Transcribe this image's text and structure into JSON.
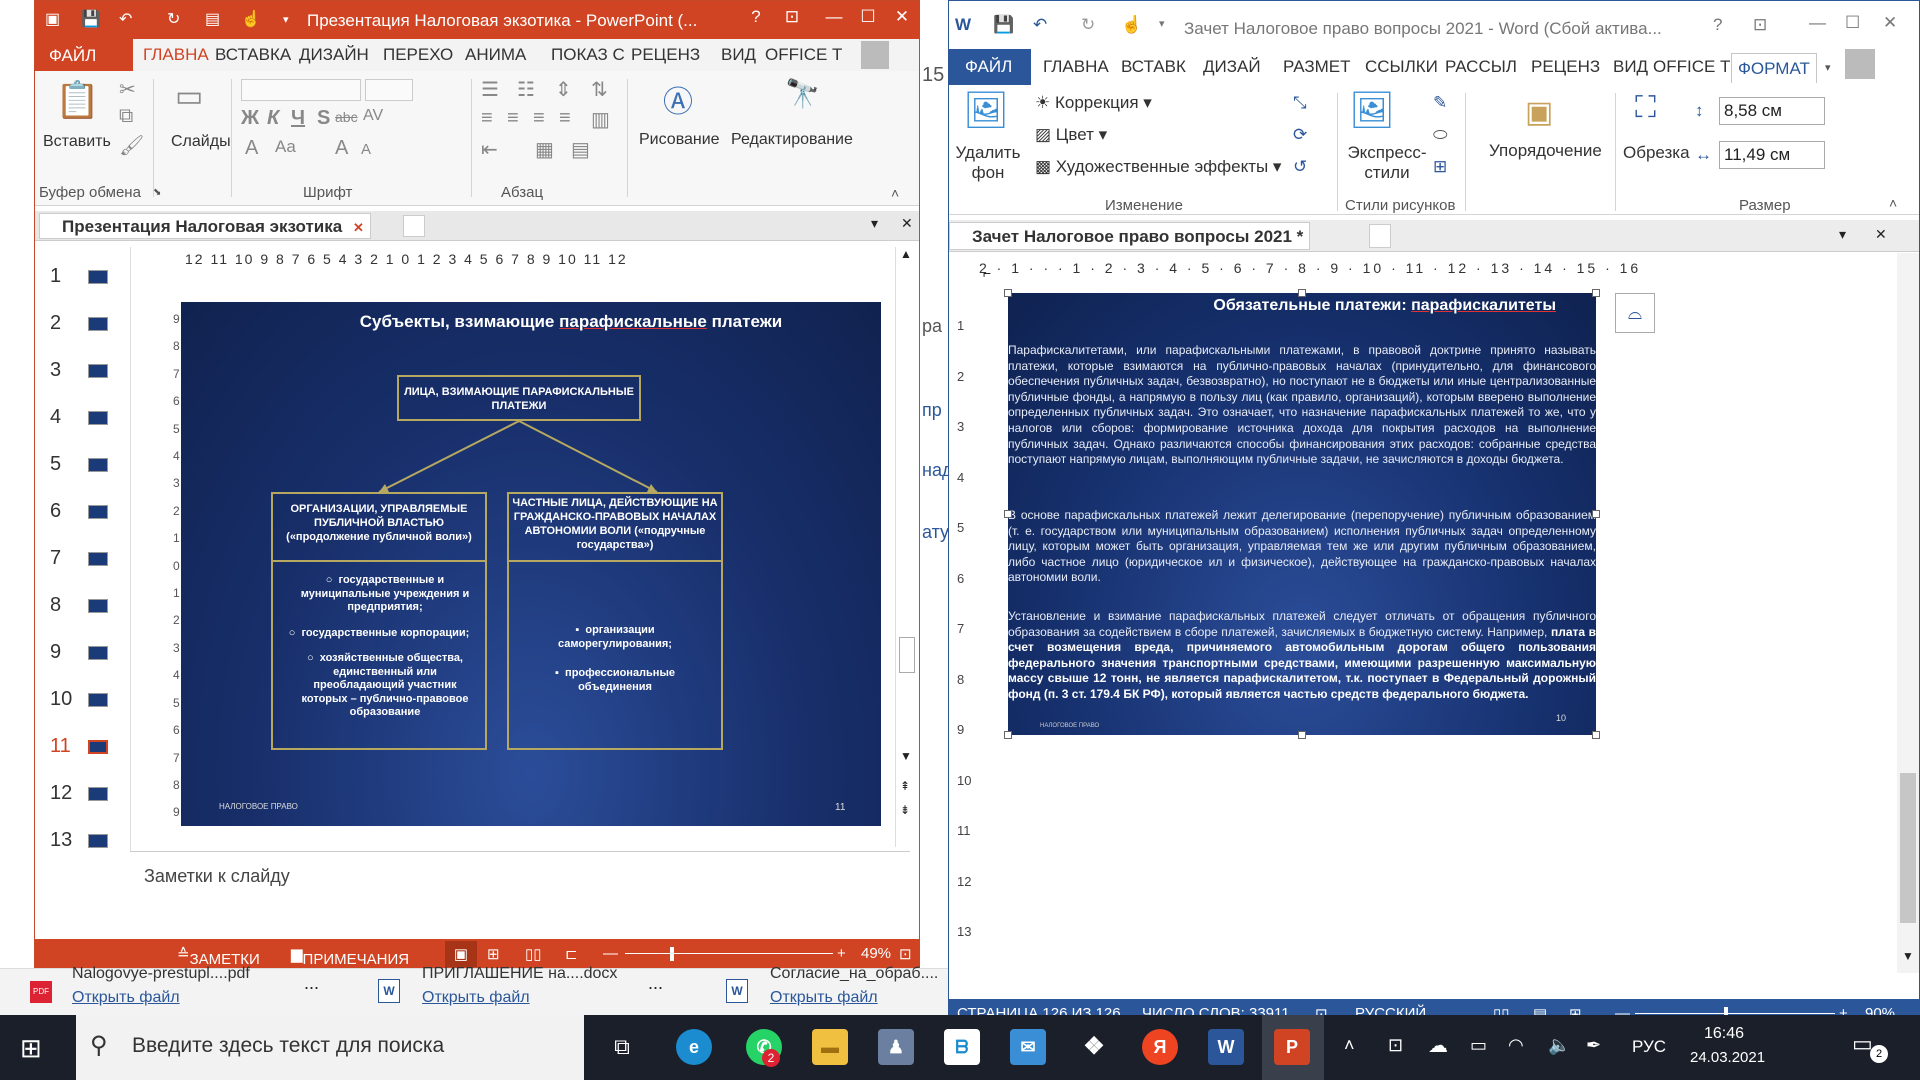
{
  "ppt": {
    "title": "Презентация Налоговая экзотика - PowerPoint (...",
    "help": "?",
    "tabs": [
      "ФАЙЛ",
      "ГЛАВНА",
      "ВСТАВКА",
      "ДИЗАЙН",
      "ПЕРЕХО",
      "АНИМА",
      "ПОКАЗ С",
      "РЕЦЕНЗ",
      "ВИД",
      "OFFICE Т"
    ],
    "ribbon": {
      "paste": "Вставить",
      "slides": "Слайды",
      "drawing": "Рисование",
      "editing": "Редактирование",
      "groups": [
        "Буфер обмена",
        "Шрифт",
        "Абзац"
      ],
      "font_letters": [
        "Ж",
        "К",
        "Ч",
        "S",
        "abc",
        "AV",
        "A",
        "Aa",
        "A",
        "A"
      ]
    },
    "doc_tab": "Презентация Налоговая экзотика",
    "ruler": "12 11 10 9 8 7 6 5 4 3 2 1 0 1 2 3 4 5 6 7 8 9 10 11 12",
    "vruler": [
      "9",
      "8",
      "7",
      "6",
      "5",
      "4",
      "3",
      "2",
      "1",
      "0",
      "1",
      "2",
      "3",
      "4",
      "5",
      "6",
      "7",
      "8",
      "9"
    ],
    "thumbnails": [
      "1",
      "2",
      "3",
      "4",
      "5",
      "6",
      "7",
      "8",
      "9",
      "10",
      "11",
      "12",
      "13"
    ],
    "selected_slide": "11",
    "notes_placeholder": "Заметки к слайду",
    "status": {
      "notes": "ЗАМЕТКИ",
      "comments": "ПРИМЕЧАНИЯ",
      "zoom": "49%",
      "zoom_value": 0.49
    }
  },
  "slide": {
    "title_pre": "Субъекты, взимающие ",
    "title_u": "парафискальные",
    "title_post": " платежи",
    "top_box": "ЛИЦА, ВЗИМАЮЩИЕ ПАРАФИСКАЛЬНЫЕ ПЛАТЕЖИ",
    "left_header": "ОРГАНИЗАЦИИ, УПРАВЛЯЕМЫЕ ПУБЛИЧНОЙ ВЛАСТЬЮ («продолжение публичной воли»)",
    "right_header": "ЧАСТНЫЕ ЛИЦА, ДЕЙСТВУЮЩИЕ НА ГРАЖДАНСКО-ПРАВОВЫХ НАЧАЛАХ АВТОНОМИИ ВОЛИ («подручные государства»)",
    "left_items": [
      "государственные и муниципальные учреждения и предприятия;",
      "государственные корпорации;",
      "хозяйственные общества, единственный или преобладающий участник которых – публично-правовое образование"
    ],
    "right_items": [
      "организации саморегулирования;",
      "профессиональные объединения"
    ],
    "footer_left": "НАЛОГОВОЕ ПРАВО",
    "footer_num": "11"
  },
  "word": {
    "title": "Зачет Налоговое право вопросы 2021 - Word (Сбой актива...",
    "help": "?",
    "tabs": [
      "ФАЙЛ",
      "ГЛАВНА",
      "ВСТАВК",
      "ДИЗАЙ",
      "РАЗМЕТ",
      "ССЫЛКИ",
      "РАССЫЛ",
      "РЕЦЕНЗ",
      "ВИД",
      "OFFICE Т",
      "ФОРМАТ"
    ],
    "ribbon": {
      "remove_bg": "Удалить фон",
      "correction": "Коррекция",
      "color": "Цвет",
      "art_effects": "Художественные эффекты",
      "change_group": "Изменение",
      "express_styles": "Экспресс-стили",
      "styles_group": "Стили рисунков",
      "arrange": "Упорядочение",
      "crop": "Обрезка",
      "height": "8,58 см",
      "width": "11,49 см",
      "size_group": "Размер"
    },
    "doc_tab": "Зачет Налоговое право вопросы 2021 *",
    "ruler": "2 · 1 · · · 1 · 2 · 3 · 4 · 5 · 6 · 7 · 8 · 9 · 10 · 11 · 12 · 13 · 14 · 15 · 16",
    "vruler": [
      "1",
      "2",
      "3",
      "4",
      "5",
      "6",
      "7",
      "8",
      "9",
      "10",
      "11",
      "12",
      "13"
    ],
    "status": {
      "page": "СТРАНИЦА 126 ИЗ 126",
      "words": "ЧИСЛО СЛОВ: 33911",
      "lang": "РУССКИЙ",
      "zoom": "90%",
      "zoom_value": 0.9
    }
  },
  "doc_image": {
    "title_pre": "Обязательные платежи: ",
    "title_u": "парафискалитеты",
    "p1": "Парафискалитетами, или парафискальными платежами, в правовой доктрине принято называть платежи, которые взимаются на публично-правовых началах (принудительно, для финансового обеспечения публичных задач, безвозвратно), но поступают не в бюджеты или иные централизованные публичные фонды, а напрямую в пользу лиц (как правило, организаций), которым вверено выполнение определенных публичных задач. Это означает, что назначение парафискальных платежей то же, что у налогов или сборов: формирование источника дохода для покрытия расходов на выполнение публичных задач. Однако различаются способы финансирования этих расходов: собранные средства поступают напрямую лицам, выполняющим публичные задачи, не зачисляются в доходы бюджета.",
    "p2": "В основе парафискальных платежей лежит делегирование (перепоручение) публичным образованием (т. е. государством или муниципальным образованием) исполнения публичных задач определенному лицу, которым может быть организация, управляемая тем же или другим публичным образованием, либо частное лицо (юридическое ил и физическое), действующее на гражданско-правовых началах автономии воли.",
    "p3_normal": "Установление и взимание парафискальных платежей следует отличать от обращения публичного образования за содействием в сборе платежей, зачисляемых в бюджетную систему. Например, ",
    "p3_bold": "плата в счет возмещения вреда, причиняемого автомобильным дорогам общего пользования федерального значения транспортными средствами, имеющими разрешенную максимальную массу свыше 12 тонн, не является парафискалитетом, т.к. поступает в Федеральный дорожный фонд (п. 3 ст. 179.4 БК РФ), который является частью средств федерального бюджета.",
    "footer_left": "НАЛОГОВОЕ ПРАВО",
    "footer_num": "10"
  },
  "filebar": [
    {
      "name": "Nalogovye-prestupl....pdf",
      "open": "Открыть файл",
      "kind": "pdf"
    },
    {
      "name": "ПРИГЛАШЕНИЕ на....docx",
      "open": "Открыть файл",
      "kind": "word"
    },
    {
      "name": "Согласие_на_обраб....",
      "open": "Открыть файл",
      "kind": "word"
    }
  ],
  "filebar_more": "...",
  "taskbar": {
    "search_placeholder": "Введите здесь текст для поиска",
    "whatsapp_badge": "2",
    "lang": "РУС",
    "time": "16:46",
    "date": "24.03.2021",
    "notif_count": "2"
  },
  "background_fragments": [
    "15",
    "ра",
    "пр",
    "над",
    "ату"
  ],
  "colors": {
    "ppt_accent": "#d04423",
    "word_accent": "#2b579a",
    "slide_border": "#b6a860",
    "slide_bg": "#182f6b"
  }
}
